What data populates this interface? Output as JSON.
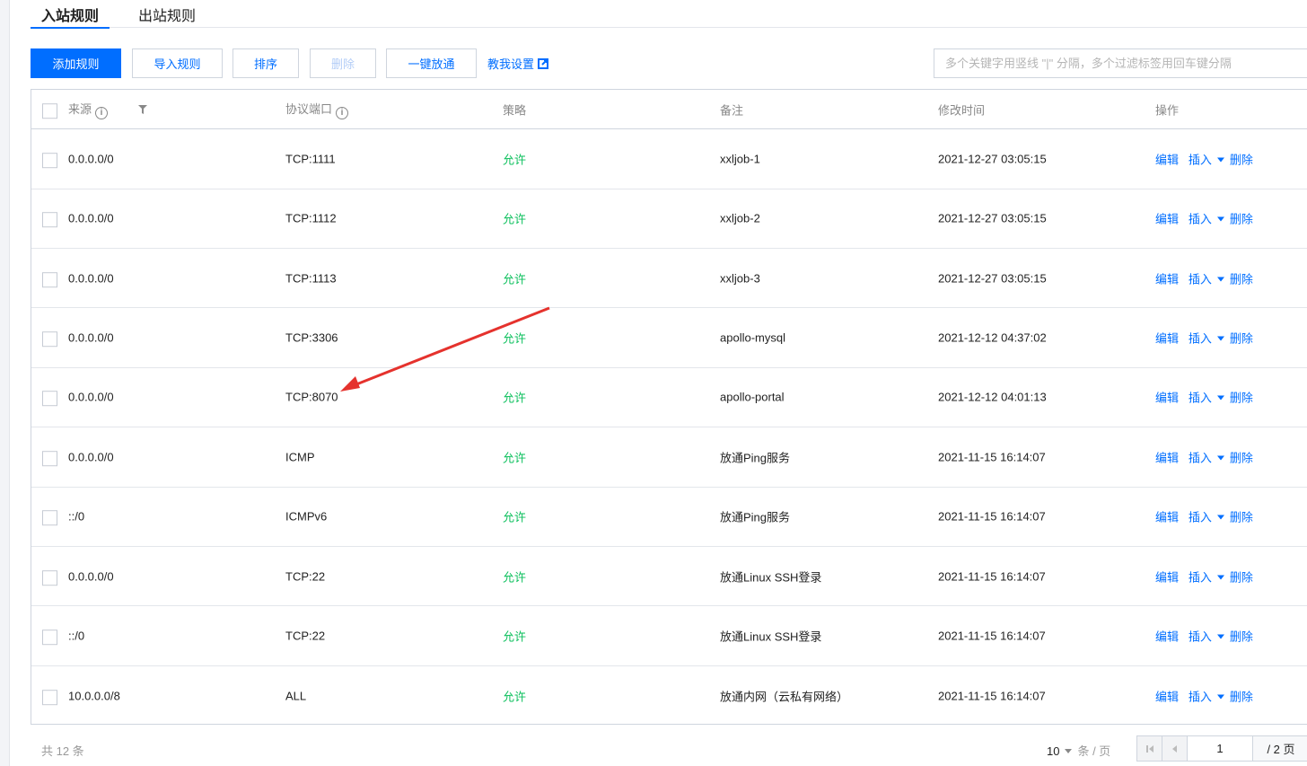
{
  "tabs": [
    "入站规则",
    "出站规则"
  ],
  "toolbar": {
    "add": "添加规则",
    "import": "导入规则",
    "sort": "排序",
    "delete": "删除",
    "open_all": "一键放通",
    "help": "教我设置",
    "search_placeholder": "多个关键字用竖线 \"|\" 分隔，多个过滤标签用回车键分隔"
  },
  "columns": {
    "source": "来源",
    "protocol": "协议端口",
    "policy": "策略",
    "note": "备注",
    "time": "修改时间",
    "ops": "操作"
  },
  "ops": {
    "edit": "编辑",
    "insert": "插入",
    "delete": "删除"
  },
  "rows": [
    {
      "source": "0.0.0.0/0",
      "protocol": "TCP:1111",
      "policy": "允许",
      "note": "xxljob-1",
      "time": "2021-12-27 03:05:15"
    },
    {
      "source": "0.0.0.0/0",
      "protocol": "TCP:1112",
      "policy": "允许",
      "note": "xxljob-2",
      "time": "2021-12-27 03:05:15"
    },
    {
      "source": "0.0.0.0/0",
      "protocol": "TCP:1113",
      "policy": "允许",
      "note": "xxljob-3",
      "time": "2021-12-27 03:05:15"
    },
    {
      "source": "0.0.0.0/0",
      "protocol": "TCP:3306",
      "policy": "允许",
      "note": "apollo-mysql",
      "time": "2021-12-12 04:37:02"
    },
    {
      "source": "0.0.0.0/0",
      "protocol": "TCP:8070",
      "policy": "允许",
      "note": "apollo-portal",
      "time": "2021-12-12 04:01:13"
    },
    {
      "source": "0.0.0.0/0",
      "protocol": "ICMP",
      "policy": "允许",
      "note": "放通Ping服务",
      "time": "2021-11-15 16:14:07"
    },
    {
      "source": "::/0",
      "protocol": "ICMPv6",
      "policy": "允许",
      "note": "放通Ping服务",
      "time": "2021-11-15 16:14:07"
    },
    {
      "source": "0.0.0.0/0",
      "protocol": "TCP:22",
      "policy": "允许",
      "note": "放通Linux SSH登录",
      "time": "2021-11-15 16:14:07"
    },
    {
      "source": "::/0",
      "protocol": "TCP:22",
      "policy": "允许",
      "note": "放通Linux SSH登录",
      "time": "2021-11-15 16:14:07"
    },
    {
      "source": "10.0.0.0/8",
      "protocol": "ALL",
      "policy": "允许",
      "note": "放通内网（云私有网络）",
      "time": "2021-11-15 16:14:07"
    }
  ],
  "footer": {
    "total": "共 12 条",
    "page_size": "10",
    "per_page": "条 / 页",
    "current_page": "1",
    "total_pages": "/ 2 页"
  },
  "colors": {
    "accent": "#006eff",
    "allow": "#0abf5b",
    "arrow": "#e5322d"
  }
}
